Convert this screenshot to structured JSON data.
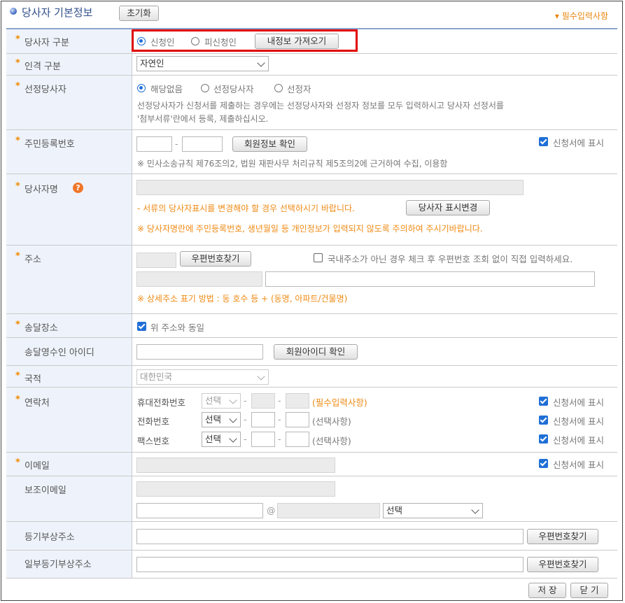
{
  "header": {
    "title": "당사자 기본정보",
    "reset_button": "초기화",
    "required_note": "필수입력사항",
    "required_note_prefix": "▾"
  },
  "party_type": {
    "label": "당사자 구분",
    "options": [
      "신청인",
      "피신청인"
    ],
    "selected": "신청인",
    "load_button": "내정보 가져오기"
  },
  "person_type": {
    "label": "인격 구분",
    "value": "자연인"
  },
  "designated_party": {
    "label": "선정당사자",
    "options": [
      "해당없음",
      "선정당사자",
      "선정자"
    ],
    "selected": "해당없음",
    "help_line1": "선정당사자가 신청서를 제출하는 경우에는 선정당사자와 선정자 정보를 모두 입력하시고 당사자 선정서를",
    "help_line2": "'첨부서류'란에서 등록, 제출하십시오."
  },
  "resident_number": {
    "label": "주민등록번호",
    "separator": "-",
    "verify_button": "회원정보 확인",
    "show_on_application": "신청서에 표시",
    "notice": "※ 민사소송규칙 제76조의2, 법원 재판사무 처리규칙 제5조의2에 근거하여 수집, 이용함"
  },
  "party_name": {
    "label": "당사자명",
    "help_icon": "?",
    "notice1": "- 서류의 당사자표시를 변경해야 할 경우 선택하시기 바랍니다.",
    "change_button": "당사자 표시변경",
    "notice2": "※ 당사자명란에 주민등록번호, 생년월일 등 개인정보가 입력되지 않도록 주의하여 주시기바랍니다."
  },
  "address": {
    "label": "주소",
    "zip_button": "우편번호찾기",
    "foreign_checkbox": "국내주소가 아닌 경우 체크 후 우편번호 조회 없이 직접 입력하세요.",
    "notice": "※ 상세주소 표기 방법 : 동 호수 등 + (동명, 아파트/건물명)"
  },
  "delivery_place": {
    "label": "송달장소",
    "same_as_address": "위 주소와 동일"
  },
  "delivery_recipient_id": {
    "label": "송달영수인 아이디",
    "verify_button": "회원아이디 확인"
  },
  "nationality": {
    "label": "국적",
    "value": "대한민국"
  },
  "contact": {
    "label": "연락처",
    "rows": [
      {
        "name": "휴대전화번호",
        "select": "선택",
        "note": "(필수입력사항)",
        "show": "신청서에 표시"
      },
      {
        "name": "전화번호",
        "select": "선택",
        "note": "(선택사항)",
        "show": "신청서에 표시"
      },
      {
        "name": "팩스번호",
        "select": "선택",
        "note": "(선택사항)",
        "show": "신청서에 표시"
      }
    ],
    "separator": "-"
  },
  "email": {
    "label": "이메일",
    "show_on_application": "신청서에 표시"
  },
  "secondary_email": {
    "label": "보조이메일",
    "at": "@",
    "domain_select": "선택"
  },
  "registry_address": {
    "label": "등기부상주소",
    "zip_button": "우편번호찾기"
  },
  "partial_registry_address": {
    "label": "일부등기부상주소",
    "zip_button": "우편번호찾기"
  },
  "footer": {
    "save_button": "저 장",
    "close_button": "닫 기"
  },
  "colors": {
    "accent_orange": "#ef8a14",
    "checkbox_blue": "#1f6fd6",
    "highlight_red": "#e00000",
    "label_bg": "#eef3fb"
  }
}
